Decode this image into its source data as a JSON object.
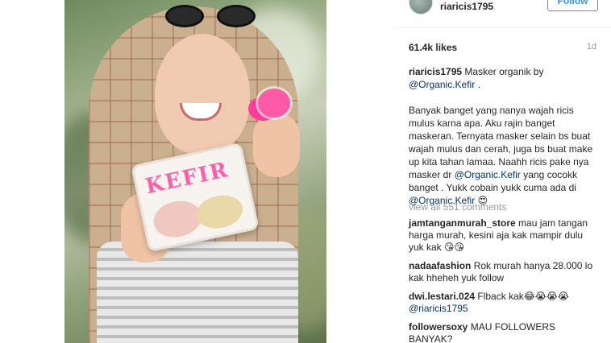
{
  "post": {
    "username": "riaricis1795",
    "follow_label": "Follow",
    "likes": "61.4k likes",
    "age": "1d"
  },
  "caption": {
    "user": "riaricis1795",
    "text_1": "Masker organik by",
    "mention_1": "@Organic.Kefir",
    "text_1_end": ".",
    "text_2": "Banyak banget yang nanya wajah ricis mulus karna apa. Aku rajin banget maskeran. Ternyata masker selain bs buat wajah mulus dan cerah, juga bs buat make up kita tahan lamaa. Naahh ricis pake nya masker dr",
    "mention_2": "@Organic.Kefir",
    "text_3": "yang cocokk banget . Yukk cobain yukk cuma ada di",
    "mention_3": "@Organic.Kefir",
    "emoji_1": "😍"
  },
  "view_all_label": "view all 551 comments",
  "comments": [
    {
      "user": "jamtanganmurah_store",
      "text": "mau jam tangan harga murah, kesini aja kak mampir dulu yuk kak",
      "emoji": "😘😘"
    },
    {
      "user": "nadaafashion",
      "text": "Rok murah hanya 28.000 lo kak hheheh yuk follow",
      "emoji": ""
    },
    {
      "user": "dwi.lestari.024",
      "text": "Flback kak",
      "emoji": "😂😭😭😭",
      "mention": "@riaricis1795"
    },
    {
      "user": "followersoxy",
      "text": "MAU FOLLOWERS BANYAK?",
      "emoji": ""
    }
  ],
  "photo": {
    "brand_label": "KEFIR",
    "accent_color": "#3897f0",
    "brand_color": "#ff5fa8"
  }
}
